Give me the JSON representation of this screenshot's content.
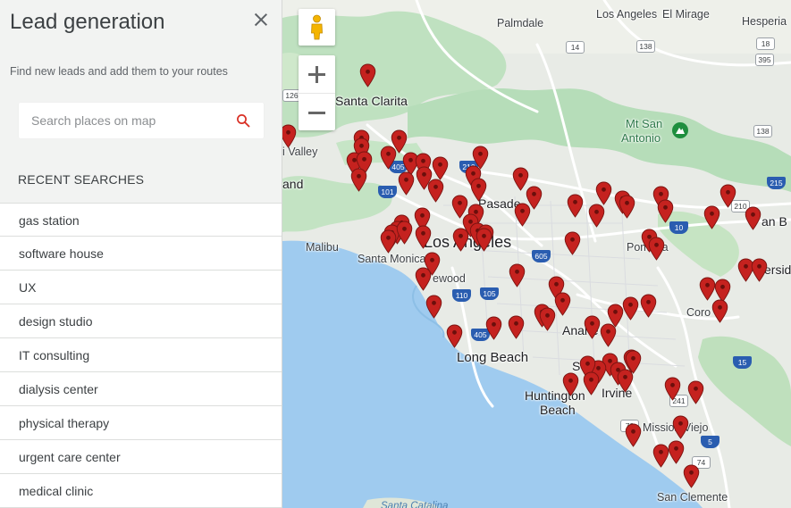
{
  "sidebar": {
    "title": "Lead generation",
    "subtitle": "Find new leads and add them to your routes",
    "search": {
      "placeholder": "Search places on map",
      "value": ""
    },
    "recent_header": "RECENT SEARCHES",
    "recent_searches": [
      "gas station",
      "software house",
      "UX",
      "design studio",
      "IT consulting",
      "dialysis center",
      "physical therapy",
      "urgent care center",
      "medical clinic"
    ]
  },
  "map": {
    "labels": {
      "palmdale": "Palmdale",
      "los_angeles": "Los Angeles",
      "el_mirage": "El Mirage",
      "hesperia": "Hesperia",
      "santa_clarita": "Santa Clarita",
      "simi_valley": "i Valley",
      "oxnard": "and",
      "malibu": "Malibu",
      "santa_monica": "Santa Monica",
      "inglewood": "ewood",
      "pasadena": "Pasade",
      "los_angeles_city": "Los Angeles",
      "pomona": "Pomona",
      "san_b": "an B",
      "riverside": "ersid",
      "corona": "Coro",
      "anaheim": "Anahe",
      "long_beach": "Long Beach",
      "santa_ana": "S",
      "huntington_beach_1": "Huntington",
      "huntington_beach_2": "Beach",
      "irvine": "Irvine",
      "mission_viejo": "Mission Viejo",
      "san_clemente": "San Clemente",
      "mt_san_antonio_1": "Mt San",
      "mt_san_antonio_2": "Antonio",
      "santa_catalina": "Santa Catalina"
    },
    "shields": {
      "s14": "14",
      "s138": "138",
      "s18": "18",
      "s395": "395",
      "s126": "126",
      "s101": "101",
      "s405a": "405",
      "s210a": "210",
      "s210b": "210",
      "s10": "10",
      "s215": "215",
      "s605": "605",
      "s110": "110",
      "s105": "105",
      "s405b": "405",
      "s15": "15",
      "s241": "241",
      "s73": "73",
      "s74": "74",
      "s5": "5"
    },
    "icons": {
      "pegman": "pegman-icon",
      "zoom_in": "plus-icon",
      "zoom_out": "minus-icon",
      "marker": "map-pin-icon",
      "park": "park-icon"
    },
    "colors": {
      "marker": "#c5221f",
      "water": "#9fcbef",
      "land": "#e8ebe6",
      "park": "#b6ddb9"
    }
  }
}
